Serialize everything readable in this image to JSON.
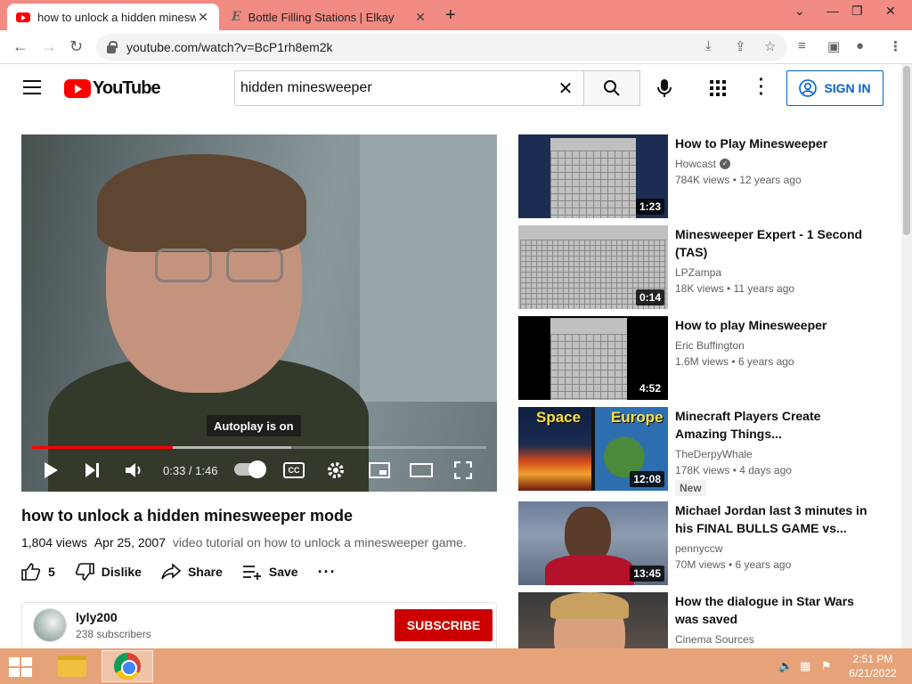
{
  "browser": {
    "tabs": [
      {
        "title": "how to unlock a hidden minesweeper mode - YouTube",
        "active": true
      },
      {
        "title": "Bottle Filling Stations | Elkay",
        "active": false
      }
    ],
    "url": "youtube.com/watch?v=BcP1rh8em2k"
  },
  "header": {
    "logo_text": "YouTube",
    "search_value": "hidden minesweeper",
    "signin_label": "SIGN IN"
  },
  "player": {
    "autoplay_tooltip": "Autoplay is on",
    "time_current": "0:33",
    "time_total": "1:46",
    "time_display": "0:33 / 1:46",
    "progress_fraction": 0.31,
    "buffered_fraction": 0.57,
    "cc_label": "CC"
  },
  "video": {
    "title": "how to unlock a hidden minesweeper mode",
    "views": "1,804 views",
    "date": "Apr 25, 2007",
    "description": "video tutorial on how to unlock a minesweeper game.",
    "likes": "5",
    "dislike_label": "Dislike",
    "share_label": "Share",
    "save_label": "Save"
  },
  "channel": {
    "name": "lyly200",
    "subscribers": "238 subscribers",
    "subscribe_label": "SUBSCRIBE"
  },
  "recommendations": [
    {
      "title": "How to Play Minesweeper",
      "channel": "Howcast",
      "verified": true,
      "views": "784K views • 12 years ago",
      "duration": "1:23"
    },
    {
      "title": "Minesweeper Expert - 1 Second (TAS)",
      "channel": "LPZampa",
      "verified": false,
      "views": "18K views • 11 years ago",
      "duration": "0:14"
    },
    {
      "title": "How to play Minesweeper",
      "channel": "Eric Buffington",
      "verified": false,
      "views": "1.6M views • 6 years ago",
      "duration": "4:52"
    },
    {
      "title": "Minecraft Players Create Amazing Things...",
      "channel": "TheDerpyWhale",
      "verified": false,
      "views": "178K views • 4 days ago",
      "duration": "12:08",
      "badge": "New",
      "thumb_text_left": "Space",
      "thumb_text_right": "Europe"
    },
    {
      "title": "Michael Jordan last 3 minutes in his FINAL BULLS GAME vs...",
      "channel": "pennyccw",
      "verified": false,
      "views": "70M views • 6 years ago",
      "duration": "13:45"
    },
    {
      "title": "How the dialogue in Star Wars was saved",
      "channel": "Cinema Sources",
      "verified": false,
      "views": "",
      "duration": ""
    }
  ],
  "taskbar": {
    "time": "2:51 PM",
    "date": "6/21/2022"
  },
  "colors": {
    "tabbar": "#f28b82",
    "youtube_red": "#ff0000",
    "signin_blue": "#065fd4",
    "subscribe_red": "#cc0000",
    "taskbar": "#e6a37a"
  }
}
